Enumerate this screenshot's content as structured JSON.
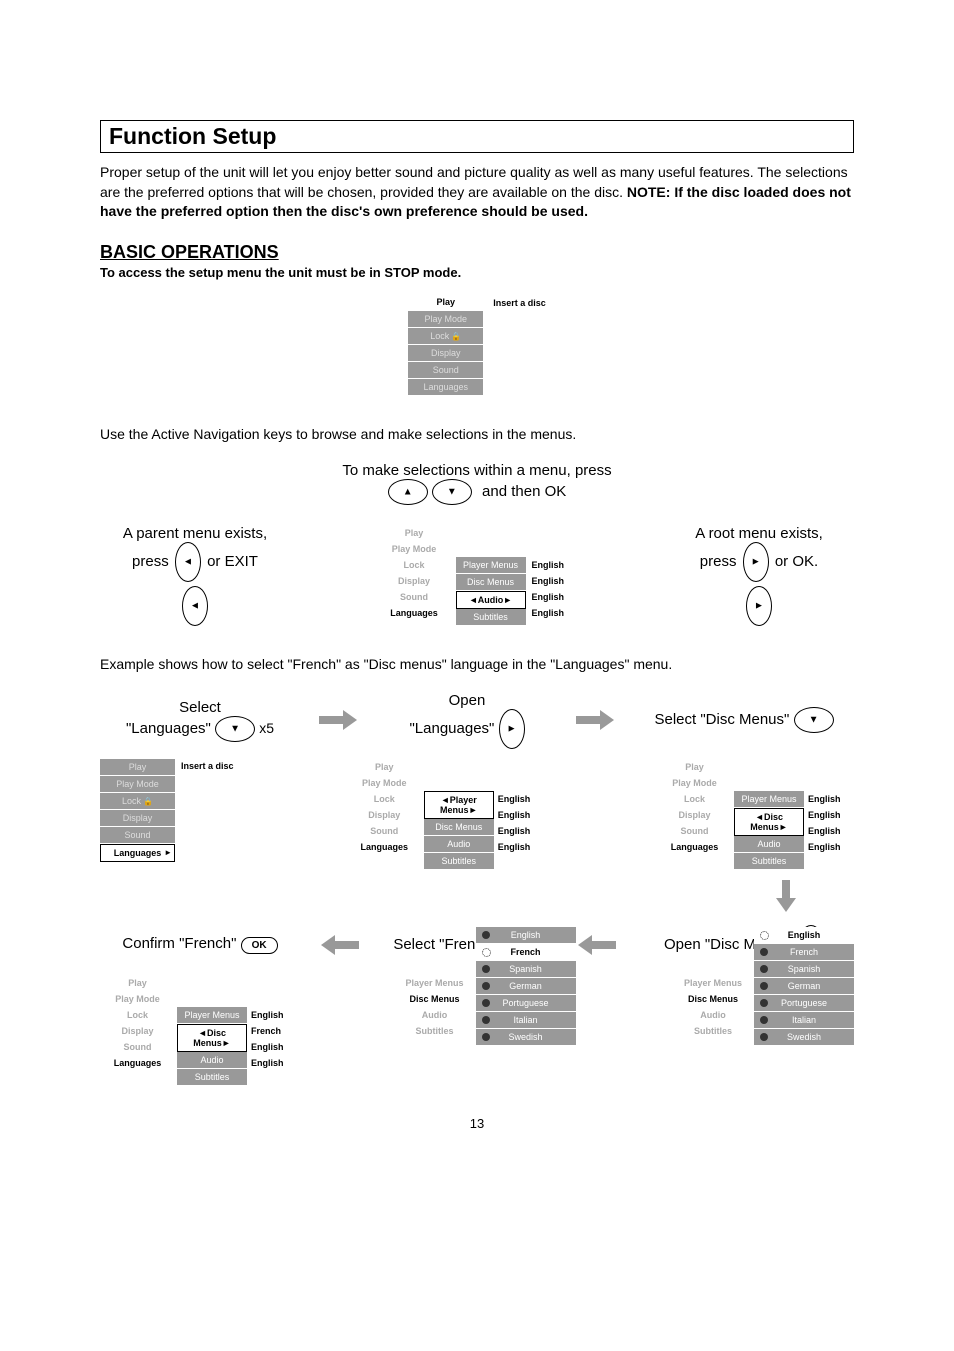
{
  "title": "Function  Setup",
  "intro_plain": "Proper setup of the unit will let you enjoy better sound and picture quality as well as many useful features.   The selections are the preferred options that will be chosen, provided they are available on the disc.  ",
  "intro_bold": "NOTE: If the disc loaded does not have the preferred option then the disc's own preference should be used.",
  "basic_ops": "BASIC OPERATIONS",
  "access_note": "To access the setup menu the unit must be in STOP mode.",
  "insert_disc": "Insert a disc",
  "main_menu": [
    "Play",
    "Play Mode",
    "Lock",
    "Display",
    "Sound",
    "Languages"
  ],
  "nav_note": "Use the Active Navigation keys to browse and make selections in the menus.",
  "selections_note_1": "To make selections within a menu, press",
  "selections_note_2": "and then OK",
  "parent_note_1": "A parent menu exists,",
  "parent_note_2_a": "press",
  "parent_note_2_b": "or EXIT",
  "root_note_1": "A root menu exists,",
  "root_note_2_a": "press",
  "root_note_2_b": "or OK.",
  "submenu_items": [
    "Player Menus",
    "Disc Menus",
    "Audio",
    "Subtitles"
  ],
  "english": "English",
  "french": "French",
  "example_note": "Example shows how to select \"French\" as \"Disc menus\" language in the \"Languages\" menu.",
  "step1_a": "Select",
  "step1_b": "\"Languages\"",
  "x5": "x5",
  "step2_a": "Open",
  "step2_b": "\"Languages\"",
  "step3": "Select \"Disc Menus\"",
  "step4": "Open \"Disc Menus\"",
  "step5": "Select \"French\"",
  "step6": "Confirm \"French\"",
  "ok": "OK",
  "lang_options": [
    "English",
    "French",
    "Spanish",
    "German",
    "Portuguese",
    "Italian",
    "Swedish"
  ],
  "page_num": "13"
}
